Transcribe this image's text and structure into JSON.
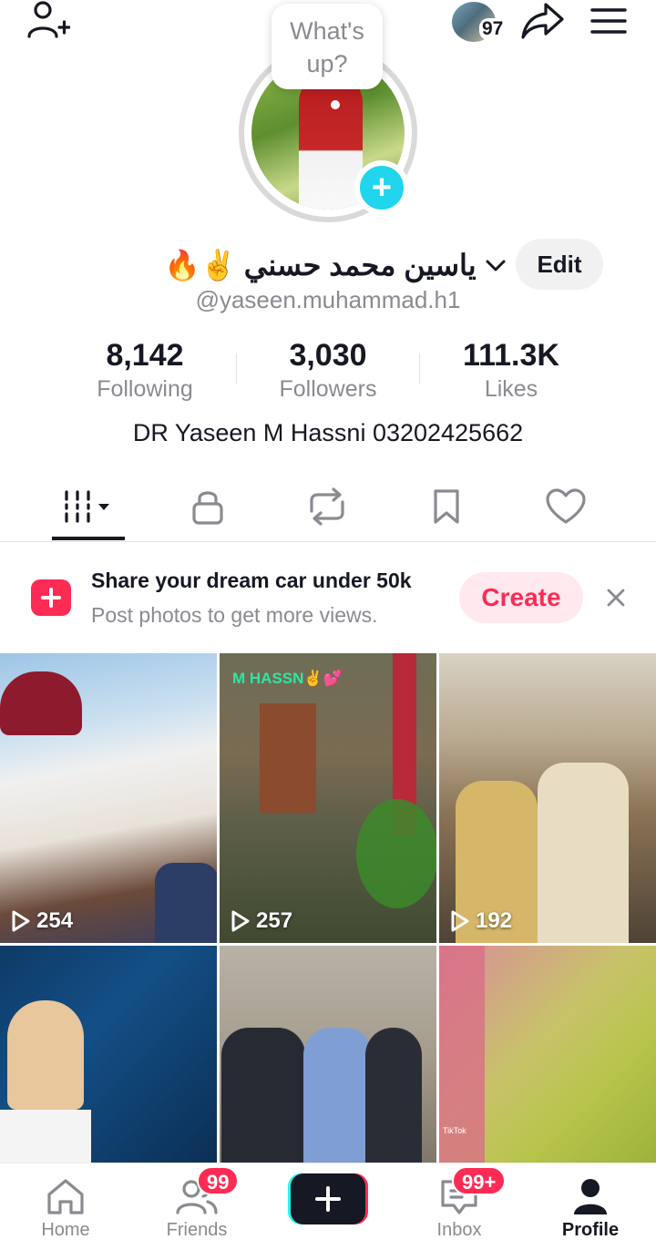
{
  "top_bar": {
    "add_friend_icon": "person-plus-icon",
    "bubble_text": "What's up?",
    "avatar_count": "97",
    "share_icon": "share-arrow-icon",
    "menu_icon": "hamburger-menu-icon"
  },
  "profile": {
    "display_name": "ياسين محمد حسني",
    "emojis": "🔥✌",
    "handle": "@yaseen.muhammad.h1",
    "edit_label": "Edit",
    "bio": "DR Yaseen M Hassni 03202425662"
  },
  "stats": [
    {
      "value": "8,142",
      "label": "Following"
    },
    {
      "value": "3,030",
      "label": "Followers"
    },
    {
      "value": "111.3K",
      "label": "Likes"
    }
  ],
  "tabs": [
    {
      "icon": "videos-grid-icon",
      "active": true
    },
    {
      "icon": "lock-icon",
      "active": false
    },
    {
      "icon": "repost-icon",
      "active": false
    },
    {
      "icon": "bookmark-icon",
      "active": false
    },
    {
      "icon": "heart-icon",
      "active": false
    }
  ],
  "promo": {
    "title": "Share your dream car under 50k",
    "subtitle": "Post photos to get more views.",
    "create_label": "Create"
  },
  "videos": [
    {
      "views": "254",
      "caption": ""
    },
    {
      "views": "257",
      "caption": "M HASSN✌💕"
    },
    {
      "views": "192",
      "caption": ""
    },
    {
      "views": "",
      "caption": ""
    },
    {
      "views": "",
      "caption": ""
    },
    {
      "views": "",
      "caption": "TikTok"
    }
  ],
  "bottom_nav": [
    {
      "label": "Home",
      "badge": ""
    },
    {
      "label": "Friends",
      "badge": "99"
    },
    {
      "label": "",
      "badge": ""
    },
    {
      "label": "Inbox",
      "badge": "99+"
    },
    {
      "label": "Profile",
      "badge": ""
    }
  ],
  "colors": {
    "accent": "#fe2c55",
    "cyan": "#25f4ee",
    "text": "#161823",
    "muted": "#8a8b91"
  }
}
